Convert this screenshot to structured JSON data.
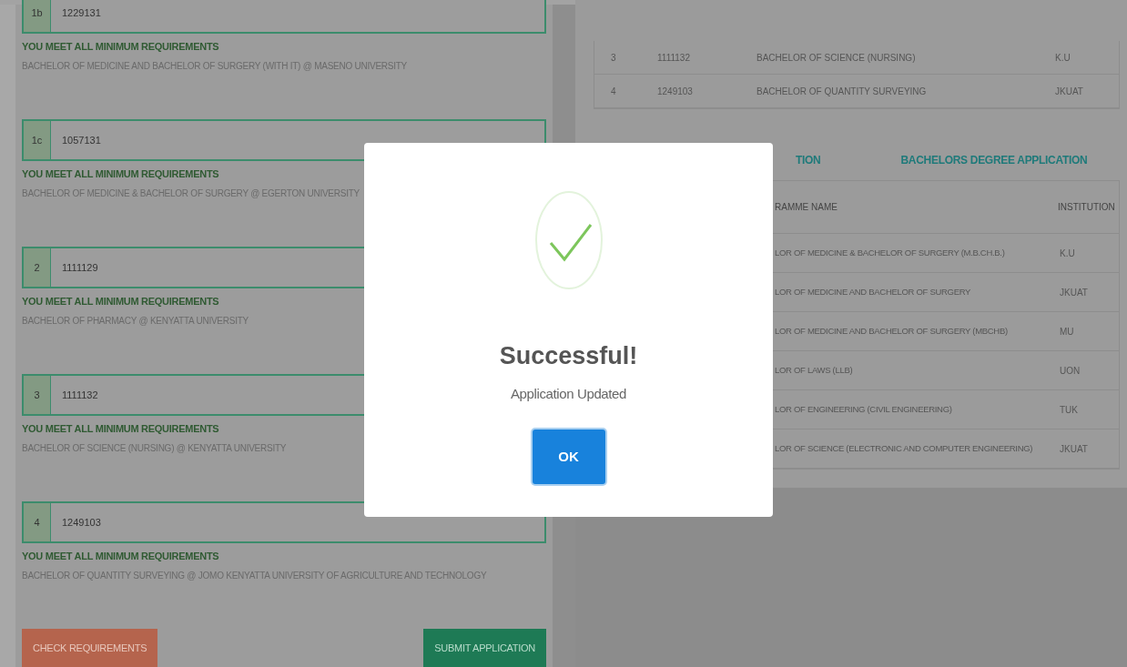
{
  "choices": [
    {
      "index": "1b",
      "code": "1229131",
      "status": "YOU MEET ALL MINIMUM REQUIREMENTS",
      "course": "BACHELOR OF MEDICINE AND BACHELOR OF SURGERY (WITH IT) @ MASENO UNIVERSITY"
    },
    {
      "index": "1c",
      "code": "1057131",
      "status": "YOU MEET ALL MINIMUM REQUIREMENTS",
      "course": "BACHELOR OF MEDICINE & BACHELOR OF SURGERY @ EGERTON UNIVERSITY"
    },
    {
      "index": "2",
      "code": "1111129",
      "status": "YOU MEET ALL MINIMUM REQUIREMENTS",
      "course": "BACHELOR OF PHARMACY @ KENYATTA UNIVERSITY"
    },
    {
      "index": "3",
      "code": "1111132",
      "status": "YOU MEET ALL MINIMUM REQUIREMENTS",
      "course": "BACHELOR OF SCIENCE (NURSING) @ KENYATTA UNIVERSITY"
    },
    {
      "index": "4",
      "code": "1249103",
      "status": "YOU MEET ALL MINIMUM REQUIREMENTS",
      "course": "BACHELOR OF QUANTITY SURVEYING @ JOMO KENYATTA UNIVERSITY OF AGRICULTURE AND TECHNOLOGY"
    }
  ],
  "buttons": [
    {
      "label": "CHECK REQUIREMENTS",
      "kind": "check"
    },
    {
      "label": "SUBMIT APPLICATION",
      "kind": "submit"
    }
  ],
  "summary_table": {
    "rows": [
      {
        "cells": [
          "3",
          "1111132",
          "BACHELOR OF SCIENCE (NURSING)",
          "K.U"
        ]
      },
      {
        "cells": [
          "4",
          "1249103",
          "BACHELOR OF QUANTITY SURVEYING",
          "JKUAT"
        ]
      }
    ]
  },
  "tabs": [
    {
      "label": "TION"
    },
    {
      "label": "BACHELORS DEGREE APPLICATION"
    }
  ],
  "programme_table": {
    "columns": [
      "RAMME NAME",
      "INSTITUTION"
    ],
    "rows": [
      {
        "programme": "LOR OF MEDICINE & BACHELOR OF SURGERY (M.B.CH.B.)",
        "institution": "K.U"
      },
      {
        "programme": "LOR OF MEDICINE AND BACHELOR OF SURGERY",
        "institution": "JKUAT"
      },
      {
        "programme": "LOR OF MEDICINE AND BACHELOR OF SURGERY (MBCHB)",
        "institution": "MU"
      },
      {
        "programme": "LOR OF LAWS (LLB)",
        "institution": "UON"
      },
      {
        "programme": "LOR OF ENGINEERING (CIVIL ENGINEERING)",
        "institution": "TUK"
      },
      {
        "programme": "LOR OF SCIENCE (ELECTRONIC AND COMPUTER ENGINEERING)",
        "institution": "JKUAT"
      }
    ]
  },
  "dialog": {
    "title": "Successful!",
    "message": "Application Updated",
    "button": "OK"
  }
}
